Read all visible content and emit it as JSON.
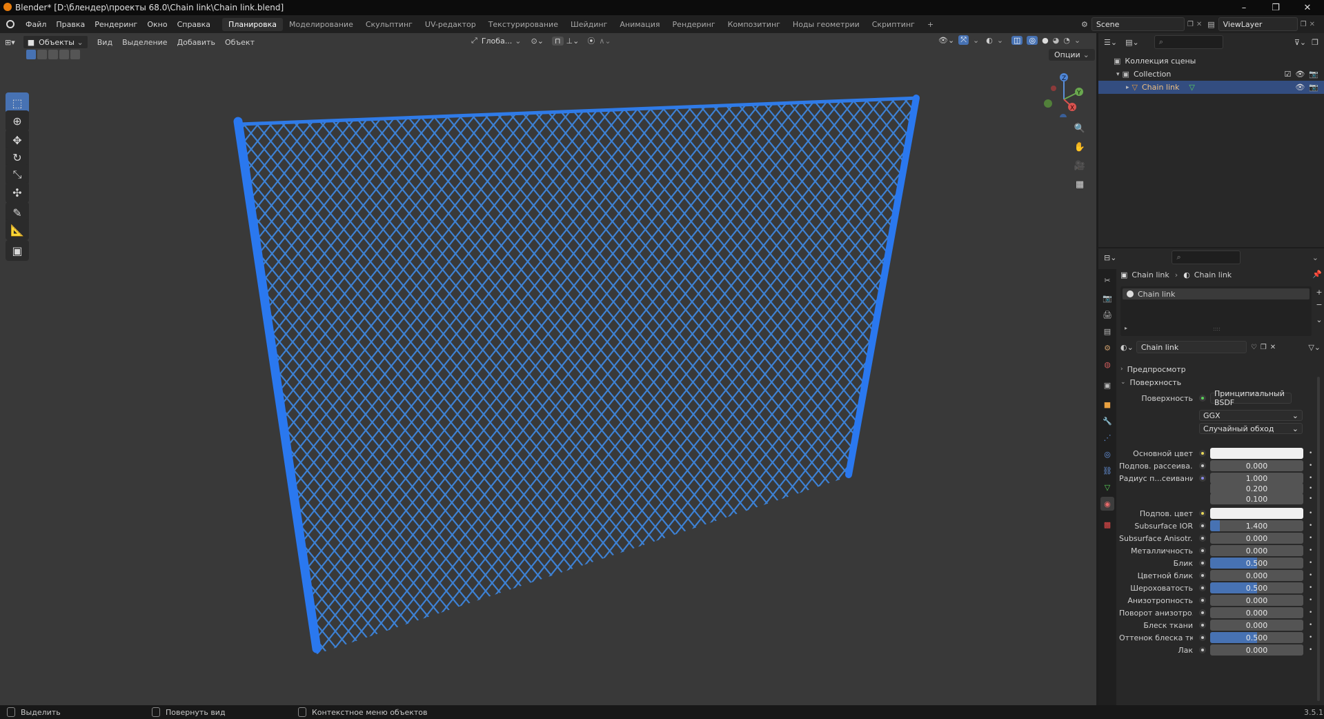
{
  "window": {
    "title": "Blender* [D:\\блендер\\проекты 68.0\\Chain link\\Chain link.blend]",
    "minimize": "–",
    "restore": "❐",
    "close": "✕"
  },
  "menu": {
    "items": [
      "Файл",
      "Правка",
      "Рендеринг",
      "Окно",
      "Справка"
    ]
  },
  "workspaces": {
    "tabs": [
      "Планировка",
      "Моделирование",
      "Скульптинг",
      "UV-редактор",
      "Текстурирование",
      "Шейдинг",
      "Анимация",
      "Рендеринг",
      "Композитинг",
      "Ноды геометрии",
      "Скриптинг"
    ],
    "active_index": 0,
    "add": "+"
  },
  "scene": {
    "name": "Scene",
    "view_layer": "ViewLayer"
  },
  "viewport": {
    "mode": "Объекты",
    "menus": [
      "Вид",
      "Выделение",
      "Добавить",
      "Объект"
    ],
    "transform_orientation": "Глоба...",
    "options": "Опции",
    "gizmo": {
      "x": "X",
      "y": "Y",
      "z": "Z"
    }
  },
  "tools": [
    {
      "name": "select-box",
      "glyph": "⬚"
    },
    {
      "name": "cursor",
      "glyph": "⊕"
    },
    {
      "name": "move",
      "glyph": "✥"
    },
    {
      "name": "rotate",
      "glyph": "↻"
    },
    {
      "name": "scale",
      "glyph": "⤡"
    },
    {
      "name": "transform",
      "glyph": "✣"
    },
    {
      "name": "annotate",
      "glyph": "✎"
    },
    {
      "name": "measure",
      "glyph": "📐"
    },
    {
      "name": "add-cube",
      "glyph": "▣"
    }
  ],
  "outliner": {
    "scene_collection": "Коллекция сцены",
    "collection": "Collection",
    "object": "Chain link"
  },
  "properties": {
    "breadcrumb_object": "Chain link",
    "breadcrumb_material": "Chain link",
    "slot_name": "Chain link",
    "material_name": "Chain link",
    "sections": {
      "preview": "Предпросмотр",
      "surface": "Поверхность"
    },
    "surface_label": "Поверхность",
    "surface_shader": "Принципиальный BSDF",
    "distribution": "GGX",
    "subsurface_method": "Случайный обход",
    "rows": [
      {
        "label": "Основной цвет",
        "type": "color",
        "dot": "yellow"
      },
      {
        "label": "Подпов. рассеива...",
        "value": "0.000",
        "fill": 0,
        "dot": "gray"
      },
      {
        "label": "Радиус п...сеивания",
        "value": "1.000",
        "fill": 0,
        "dot": "blue"
      },
      {
        "label": "",
        "value": "0.200",
        "fill": 0,
        "dot": "none"
      },
      {
        "label": "",
        "value": "0.100",
        "fill": 0,
        "dot": "none"
      },
      {
        "label": "Подпов. цвет",
        "type": "color",
        "dot": "yellow"
      },
      {
        "label": "Subsurface IOR",
        "value": "1.400",
        "fill": 0.1,
        "dot": "gray"
      },
      {
        "label": "Subsurface Anisotr...",
        "value": "0.000",
        "fill": 0,
        "dot": "gray"
      },
      {
        "label": "Металличность",
        "value": "0.000",
        "fill": 0,
        "dot": "gray"
      },
      {
        "label": "Блик",
        "value": "0.500",
        "fill": 0.5,
        "dot": "gray"
      },
      {
        "label": "Цветной блик",
        "value": "0.000",
        "fill": 0,
        "dot": "gray"
      },
      {
        "label": "Шероховатость",
        "value": "0.500",
        "fill": 0.5,
        "dot": "gray"
      },
      {
        "label": "Анизотропность",
        "value": "0.000",
        "fill": 0,
        "dot": "gray"
      },
      {
        "label": "Поворот анизотро...",
        "value": "0.000",
        "fill": 0,
        "dot": "gray"
      },
      {
        "label": "Блеск ткани",
        "value": "0.000",
        "fill": 0,
        "dot": "gray"
      },
      {
        "label": "Оттенок блеска тк...",
        "value": "0.500",
        "fill": 0.5,
        "dot": "gray"
      },
      {
        "label": "Лак",
        "value": "0.000",
        "fill": 0,
        "dot": "gray"
      }
    ]
  },
  "statusbar": {
    "select": "Выделить",
    "rotate_view": "Повернуть вид",
    "context_menu": "Контекстное меню объектов",
    "version": "3.5.1"
  }
}
